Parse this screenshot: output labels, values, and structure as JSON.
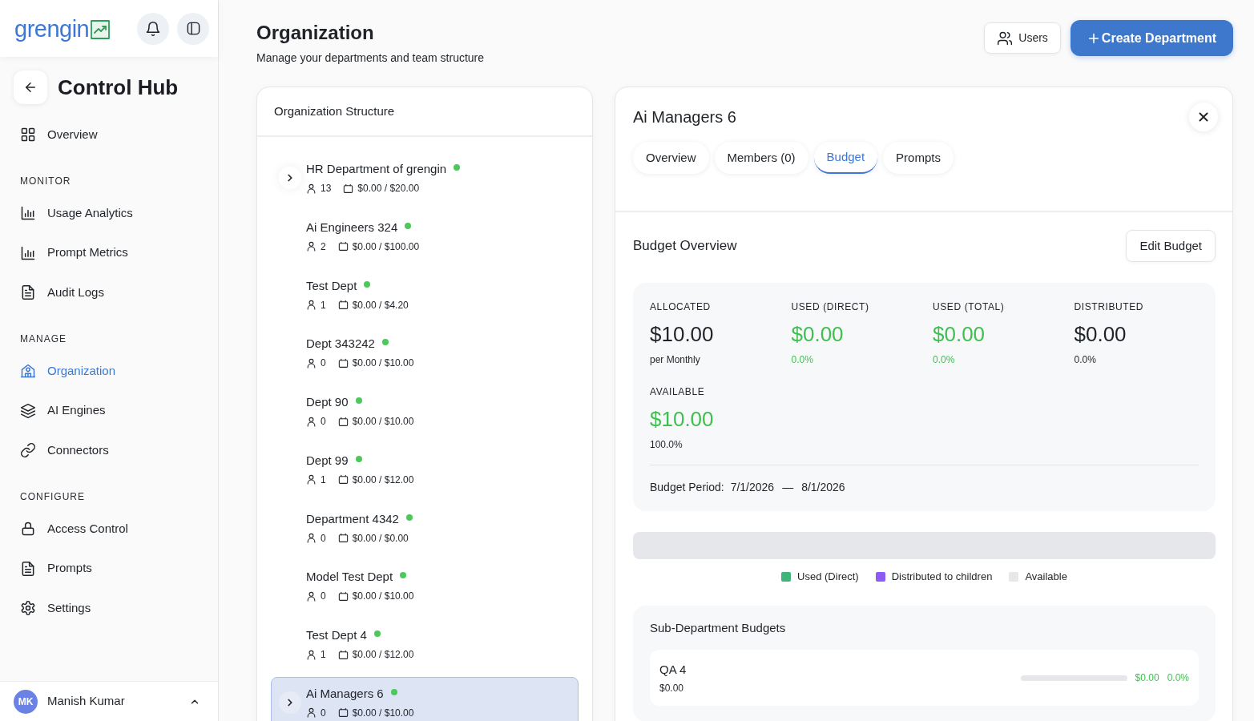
{
  "sidebar": {
    "logo": "grengin",
    "title": "Control Hub",
    "sections": [
      {
        "items": [
          {
            "label": "Overview",
            "selected": false
          }
        ]
      },
      {
        "heading": "MONITOR",
        "items": [
          {
            "label": "Usage Analytics",
            "selected": false
          },
          {
            "label": "Prompt Metrics",
            "selected": false
          },
          {
            "label": "Audit Logs",
            "selected": false
          }
        ]
      },
      {
        "heading": "MANAGE",
        "items": [
          {
            "label": "Organization",
            "selected": true
          },
          {
            "label": "AI Engines",
            "selected": false
          },
          {
            "label": "Connectors",
            "selected": false
          }
        ]
      },
      {
        "heading": "CONFIGURE",
        "items": [
          {
            "label": "Access Control",
            "selected": false
          },
          {
            "label": "Prompts",
            "selected": false
          },
          {
            "label": "Settings",
            "selected": false
          }
        ]
      }
    ],
    "user": {
      "initials": "MK",
      "name": "Manish Kumar"
    }
  },
  "header": {
    "title": "Organization",
    "subtitle": "Manage your departments and team structure",
    "actions": [
      {
        "kind": "secondary",
        "label": "Users"
      },
      {
        "kind": "primary",
        "label": "Create Department"
      }
    ]
  },
  "org_structure": {
    "title": "Organization Structure",
    "departments": [
      {
        "name": "HR Department of grengin",
        "active": true,
        "expandable": true,
        "selected": false,
        "members": "13",
        "budget": "$0.00 / $20.00"
      },
      {
        "name": "Ai Engineers 324",
        "active": true,
        "expandable": false,
        "selected": false,
        "members": "2",
        "budget": "$0.00 / $100.00"
      },
      {
        "name": "Test Dept",
        "active": true,
        "expandable": false,
        "selected": false,
        "members": "1",
        "budget": "$0.00 / $4.20"
      },
      {
        "name": "Dept 343242",
        "active": true,
        "expandable": false,
        "selected": false,
        "members": "0",
        "budget": "$0.00 / $10.00"
      },
      {
        "name": "Dept 90",
        "active": true,
        "expandable": false,
        "selected": false,
        "members": "0",
        "budget": "$0.00 / $10.00"
      },
      {
        "name": "Dept 99",
        "active": true,
        "expandable": false,
        "selected": false,
        "members": "1",
        "budget": "$0.00 / $12.00"
      },
      {
        "name": "Department 4342",
        "active": true,
        "expandable": false,
        "selected": false,
        "members": "0",
        "budget": "$0.00 / $0.00"
      },
      {
        "name": "Model Test Dept",
        "active": true,
        "expandable": false,
        "selected": false,
        "members": "0",
        "budget": "$0.00 / $10.00"
      },
      {
        "name": "Test Dept 4",
        "active": true,
        "expandable": false,
        "selected": false,
        "members": "1",
        "budget": "$0.00 / $12.00"
      },
      {
        "name": "Ai Managers 6",
        "active": true,
        "expandable": true,
        "selected": true,
        "members": "0",
        "budget": "$0.00 / $10.00"
      }
    ]
  },
  "detail": {
    "title": "Ai Managers 6",
    "tabs": [
      {
        "label": "Overview",
        "selected": false
      },
      {
        "label": "Members (0)",
        "selected": false
      },
      {
        "label": "Budget",
        "selected": true
      },
      {
        "label": "Prompts",
        "selected": false
      }
    ],
    "budget": {
      "title": "Budget Overview",
      "edit_label": "Edit Budget",
      "stats": [
        {
          "label": "ALLOCATED",
          "value": "$10.00",
          "note": "per Monthly",
          "positive": false,
          "note_positive": false
        },
        {
          "label": "USED (DIRECT)",
          "value": "$0.00",
          "note": "0.0%",
          "positive": true,
          "note_positive": true
        },
        {
          "label": "USED (TOTAL)",
          "value": "$0.00",
          "note": "0.0%",
          "positive": true,
          "note_positive": true
        },
        {
          "label": "DISTRIBUTED",
          "value": "$0.00",
          "note": "0.0%",
          "positive": false,
          "note_positive": false
        },
        {
          "label": "AVAILABLE",
          "value": "$10.00",
          "note": "100.0%",
          "positive": true,
          "note_positive": false
        }
      ],
      "period": {
        "label": "Budget Period:",
        "start": "7/1/2026",
        "separator": "—",
        "end": "8/1/2026"
      },
      "usage_bar": {
        "level": 0
      },
      "legend": [
        {
          "label": "Used (Direct)",
          "color": "#3fb57a"
        },
        {
          "label": "Distributed to children",
          "color": "#8b5cf6"
        },
        {
          "label": "Available",
          "color": "#e5e7eb"
        }
      ],
      "sub_departments": {
        "title": "Sub-Department Budgets",
        "items": [
          {
            "name": "QA 4",
            "budget": "$0.00",
            "level": 0,
            "spent": "$0.00",
            "percent": "0.0%"
          }
        ]
      }
    }
  }
}
